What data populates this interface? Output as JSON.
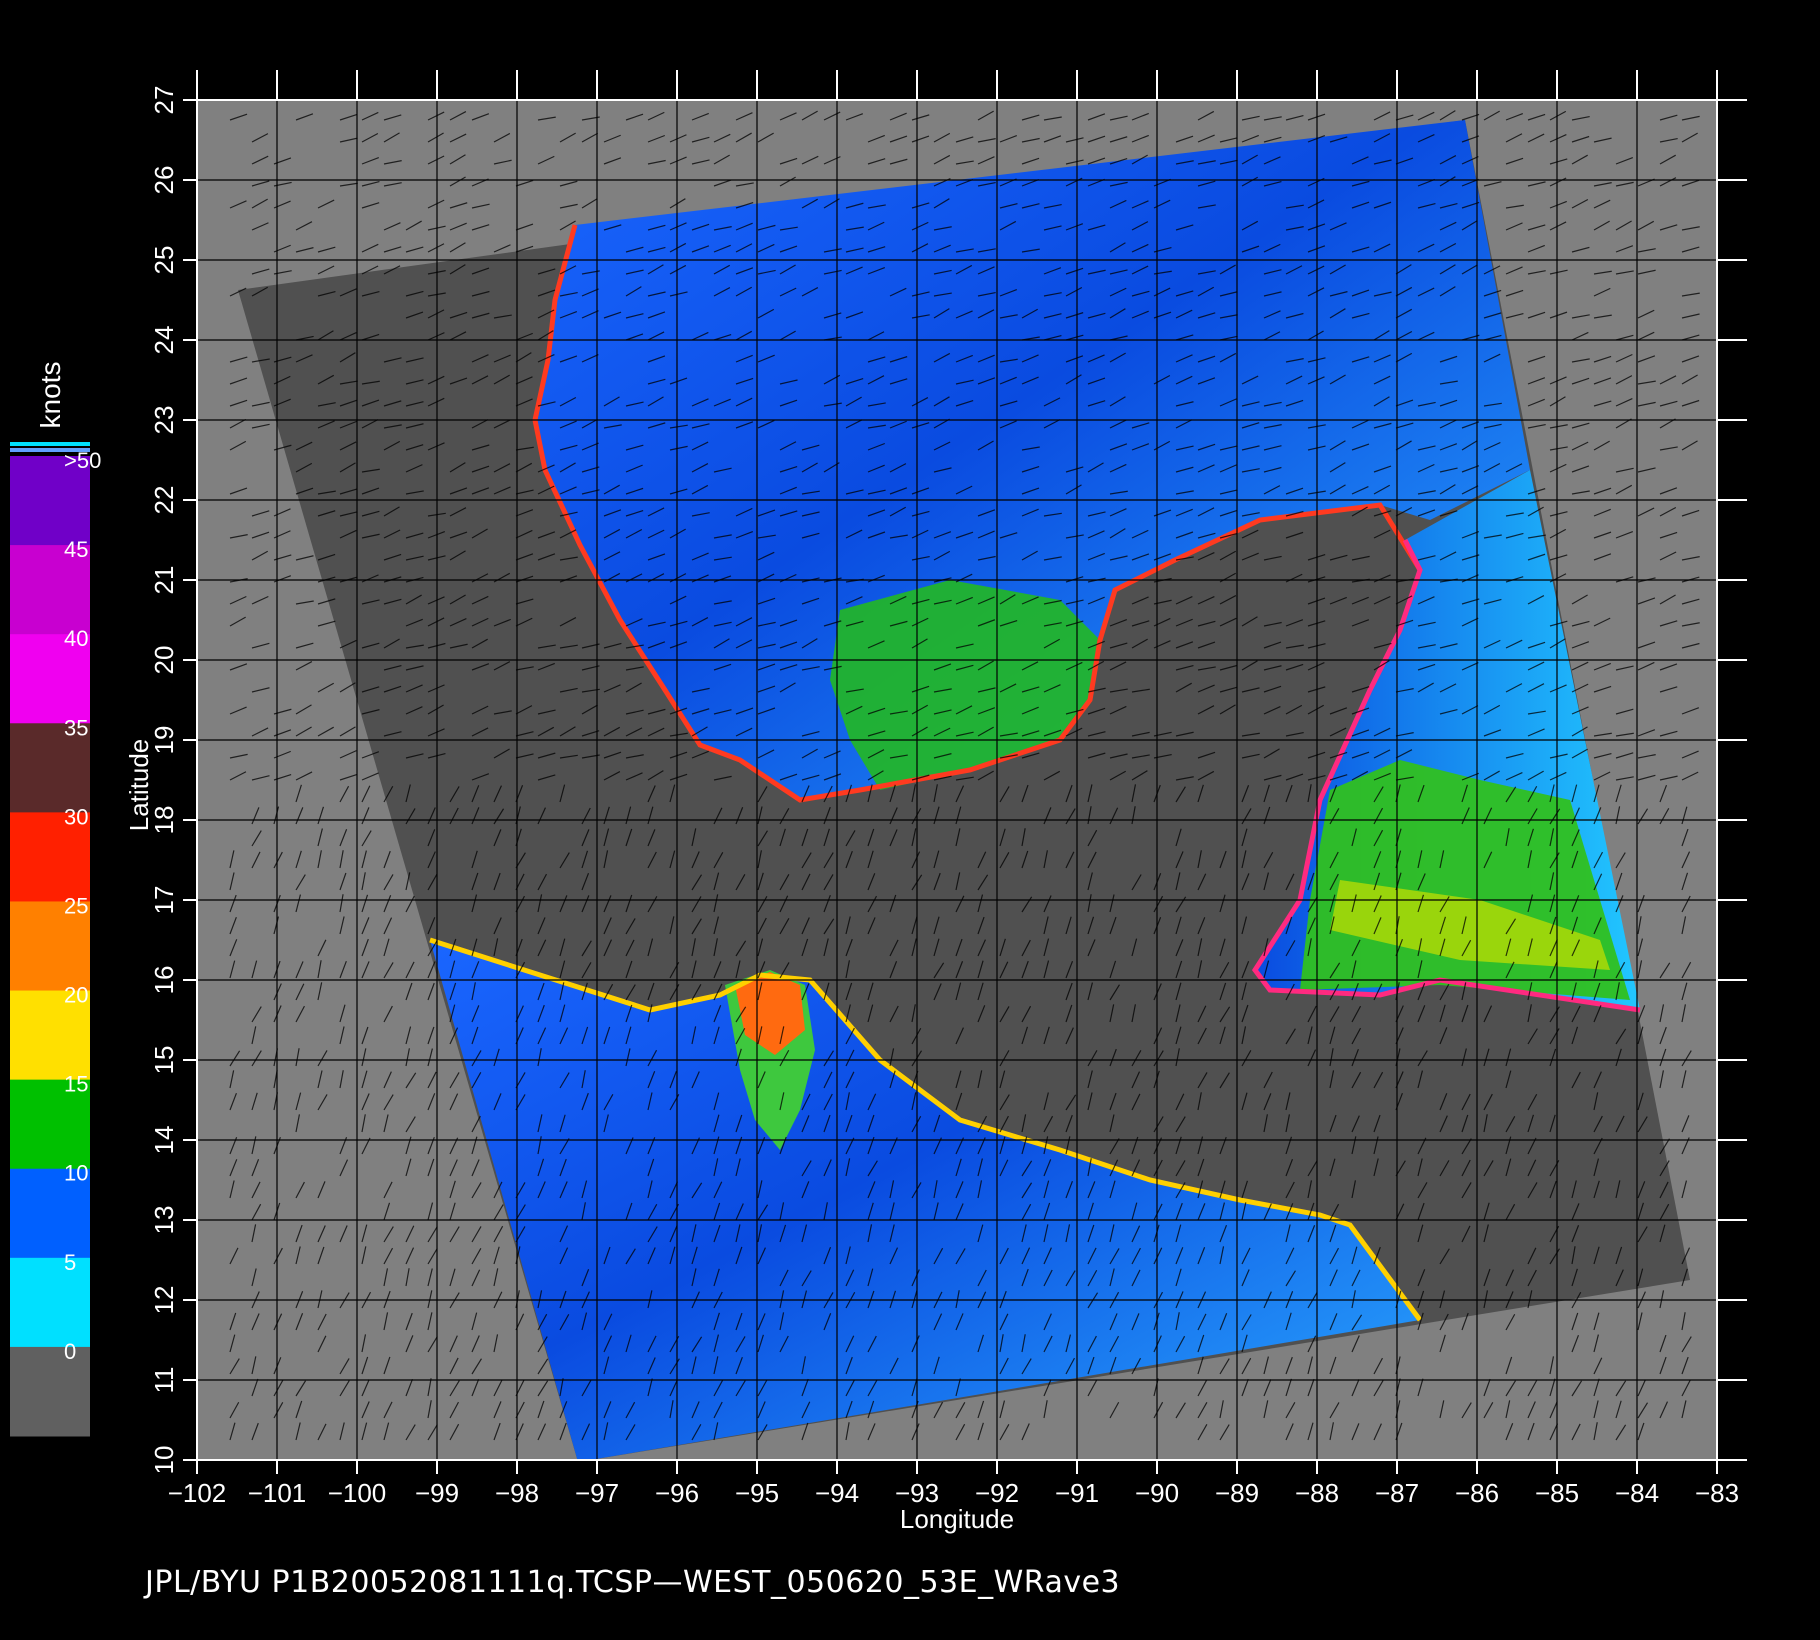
{
  "map": {
    "xlabel": "Longitude",
    "ylabel": "Latitude",
    "lon_range": [
      -102,
      -83
    ],
    "lat_range": [
      10,
      27
    ],
    "lon_ticks": [
      "-102",
      "-101",
      "-100",
      "-99",
      "-98",
      "-97",
      "-96",
      "-95",
      "-94",
      "-93",
      "-92",
      "-91",
      "-90",
      "-89",
      "-88",
      "-87",
      "-86",
      "-85",
      "-84",
      "-83"
    ],
    "lat_ticks": [
      "10",
      "11",
      "12",
      "13",
      "14",
      "15",
      "16",
      "17",
      "18",
      "19",
      "20",
      "21",
      "22",
      "23",
      "24",
      "25",
      "26",
      "27"
    ],
    "grid": "on",
    "colors": {
      "background": "#000000",
      "no_data": "#808080",
      "land": "#505050",
      "grid": "#000000",
      "axis": "#ffffff"
    }
  },
  "colorbar": {
    "title": "knots",
    "labels": [
      ">50",
      "45",
      "40",
      "35",
      "30",
      "25",
      "20",
      "15",
      "10",
      "5",
      "0"
    ],
    "colors": [
      "#7000c8",
      "#c800d0",
      "#f000f0",
      "#5a2a2a",
      "#ff2000",
      "#ff8000",
      "#ffe000",
      "#00c000",
      "#0060ff",
      "#00e0ff",
      "#606060"
    ]
  },
  "footer": "JPL/BYU  P1B20052081111q.TCSP—WEST_050620_53E_WRave3"
}
